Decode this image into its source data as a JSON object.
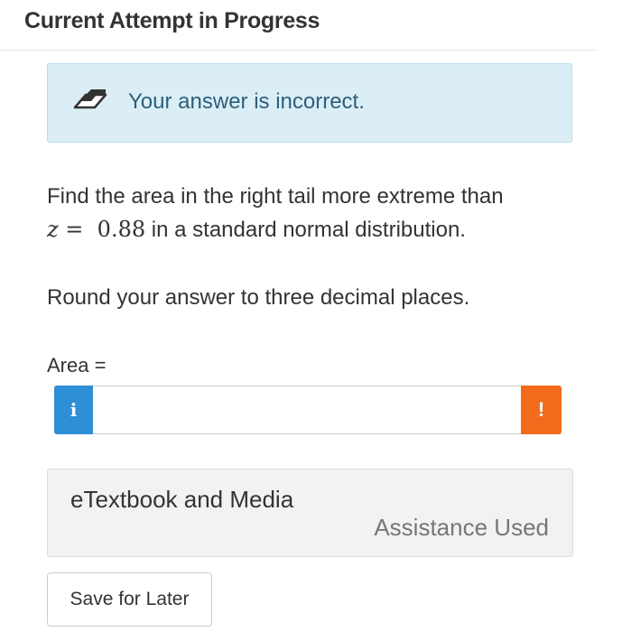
{
  "header": {
    "title": "Current Attempt in Progress"
  },
  "feedback": {
    "icon": "eraser-icon",
    "message": "Your answer is incorrect.",
    "color": "#dbeef6"
  },
  "question": {
    "text_before": "Find the area in the right tail more extreme than",
    "z_var": "z",
    "z_equals": "=",
    "z_value": "0.88",
    "text_after": "in a standard normal distribution.",
    "instruction": "Round your answer to three decimal places."
  },
  "answer": {
    "label": "Area =",
    "value": "",
    "info_button": "i",
    "warning_button": "!",
    "info_color": "#2e8fd6",
    "warning_color": "#f26b1d"
  },
  "resources": {
    "title": "eTextbook and Media",
    "status": "Assistance Used"
  },
  "actions": {
    "save_label": "Save for Later"
  }
}
